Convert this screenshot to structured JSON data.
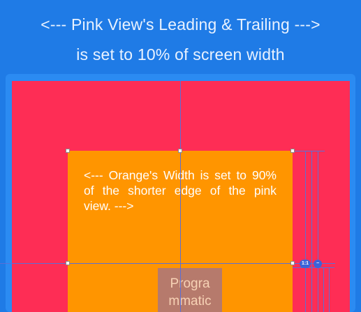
{
  "header": {
    "line1": "<--- Pink View's Leading & Trailing --->",
    "line2": "is set to 10% of screen width"
  },
  "orange": {
    "text": "<--- Orange's Width is set to 90% of the shorter edge of the pink view. --->"
  },
  "label": {
    "line1": "Progra",
    "line2": "mmatic"
  },
  "badges": {
    "ratio": "1:1",
    "minus": "−"
  },
  "colors": {
    "background": "#1f7be6",
    "pink": "#fe2d55",
    "orange": "#ff9500",
    "guide": "#5a6fd6"
  }
}
